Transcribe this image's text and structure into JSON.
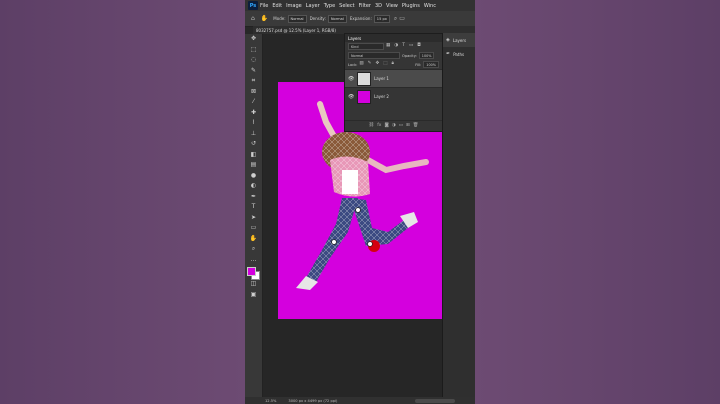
{
  "menubar": {
    "logo": "Ps",
    "items": [
      "File",
      "Edit",
      "Image",
      "Layer",
      "Type",
      "Select",
      "Filter",
      "3D",
      "View",
      "Plugins",
      "Winc"
    ]
  },
  "options_bar": {
    "mode_label": "Mode:",
    "mode_value": "Normal",
    "density_label": "Density:",
    "density_value": "Normal",
    "expansion_label": "Expansion:",
    "expansion_value": "15 px"
  },
  "document_tab": {
    "title": "8032757.psd @ 12.5% (Layer 1, RGB/8)"
  },
  "status_bar": {
    "zoom": "12.5%",
    "doc_size": "3000 px x 4499 px (72 ppi)"
  },
  "colors": {
    "foreground": "#d400de",
    "background": "#ffffff",
    "canvas": "#d400de"
  },
  "layers_panel": {
    "title": "Layers",
    "kind_placeholder": "Kind",
    "blend_mode": "Normal",
    "opacity_label": "Opacity:",
    "opacity_value": "100%",
    "lock_label": "Lock:",
    "fill_label": "Fill:",
    "fill_value": "100%",
    "layers": [
      {
        "name": "Layer 1",
        "selected": true,
        "thumb": "person"
      },
      {
        "name": "Layer 2",
        "selected": false,
        "thumb": "magenta"
      }
    ]
  },
  "dock": {
    "items": [
      "Layers",
      "Paths"
    ]
  },
  "tools": [
    "move",
    "artboard",
    "lasso",
    "quick-select",
    "crop",
    "frame",
    "eyedropper",
    "healing",
    "brush",
    "clone",
    "history",
    "eraser",
    "gradient",
    "blur",
    "dodge",
    "pen",
    "type",
    "path-select",
    "rectangle",
    "hand",
    "zoom"
  ]
}
